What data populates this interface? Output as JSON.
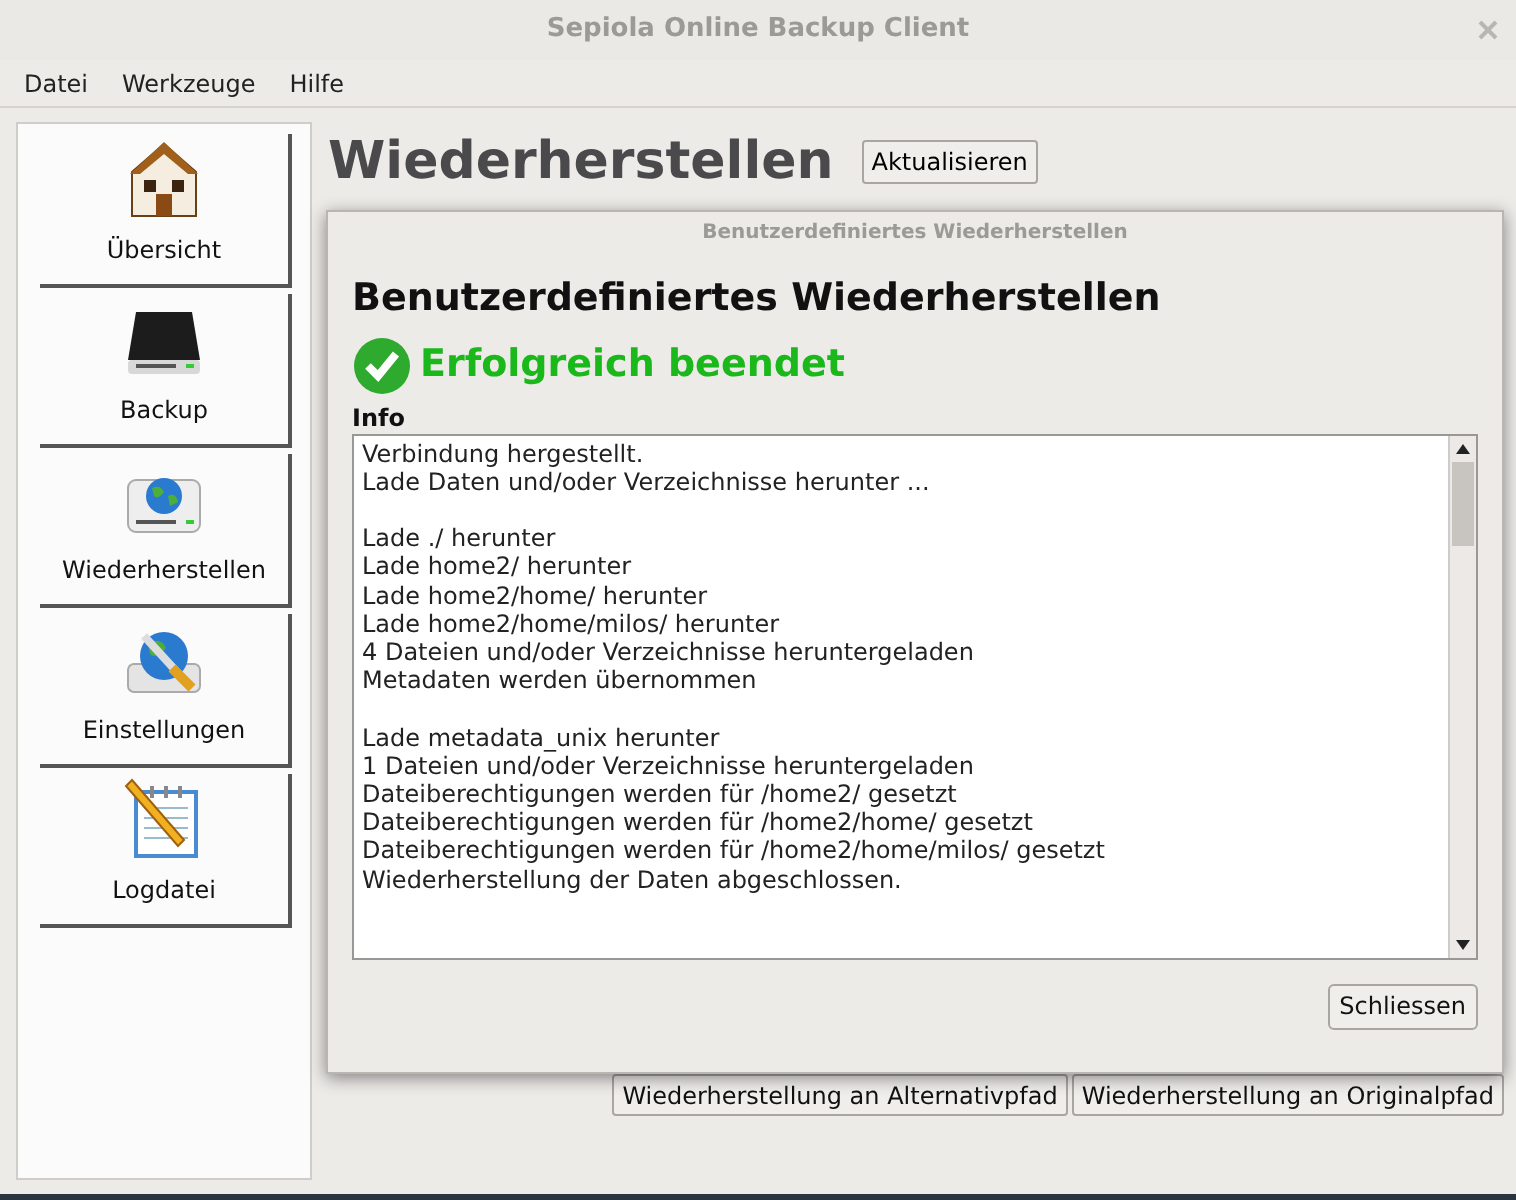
{
  "window": {
    "title": "Sepiola Online Backup Client"
  },
  "menu": [
    "Datei",
    "Werkzeuge",
    "Hilfe"
  ],
  "sidebar": {
    "items": [
      {
        "label": "Übersicht",
        "kind": "house"
      },
      {
        "label": "Backup",
        "kind": "drive"
      },
      {
        "label": "Wiederherstellen",
        "kind": "globe-drive"
      },
      {
        "label": "Einstellungen",
        "kind": "tools"
      },
      {
        "label": "Logdatei",
        "kind": "notepad"
      }
    ]
  },
  "page": {
    "heading": "Wiederherstellen",
    "refresh_button": "Aktualisieren",
    "buttons": [
      "Wiederherstellung an Alternativpfad",
      "Wiederherstellung an Originalpfad"
    ]
  },
  "dialog": {
    "title": "Benutzerdefiniertes Wiederherstellen",
    "heading": "Benutzerdefiniertes Wiederherstellen",
    "status": "Erfolgreich beendet",
    "info_label": "Info",
    "log_blocks": [
      [
        "Verbindung hergestellt.",
        "Lade Daten und/oder Verzeichnisse herunter ..."
      ],
      [
        "Lade ./ herunter",
        "Lade home2/ herunter",
        "Lade home2/home/ herunter",
        "Lade home2/home/milos/ herunter",
        "4 Dateien und/oder Verzeichnisse heruntergeladen",
        "Metadaten werden übernommen"
      ],
      [
        "Lade metadata_unix herunter",
        "1 Dateien und/oder Verzeichnisse heruntergeladen",
        "Dateiberechtigungen werden für /home2/ gesetzt",
        "Dateiberechtigungen werden für /home2/home/ gesetzt",
        "Dateiberechtigungen werden für /home2/home/milos/ gesetzt",
        "Wiederherstellung der Daten abgeschlossen."
      ]
    ],
    "close_button": "Schliessen"
  }
}
